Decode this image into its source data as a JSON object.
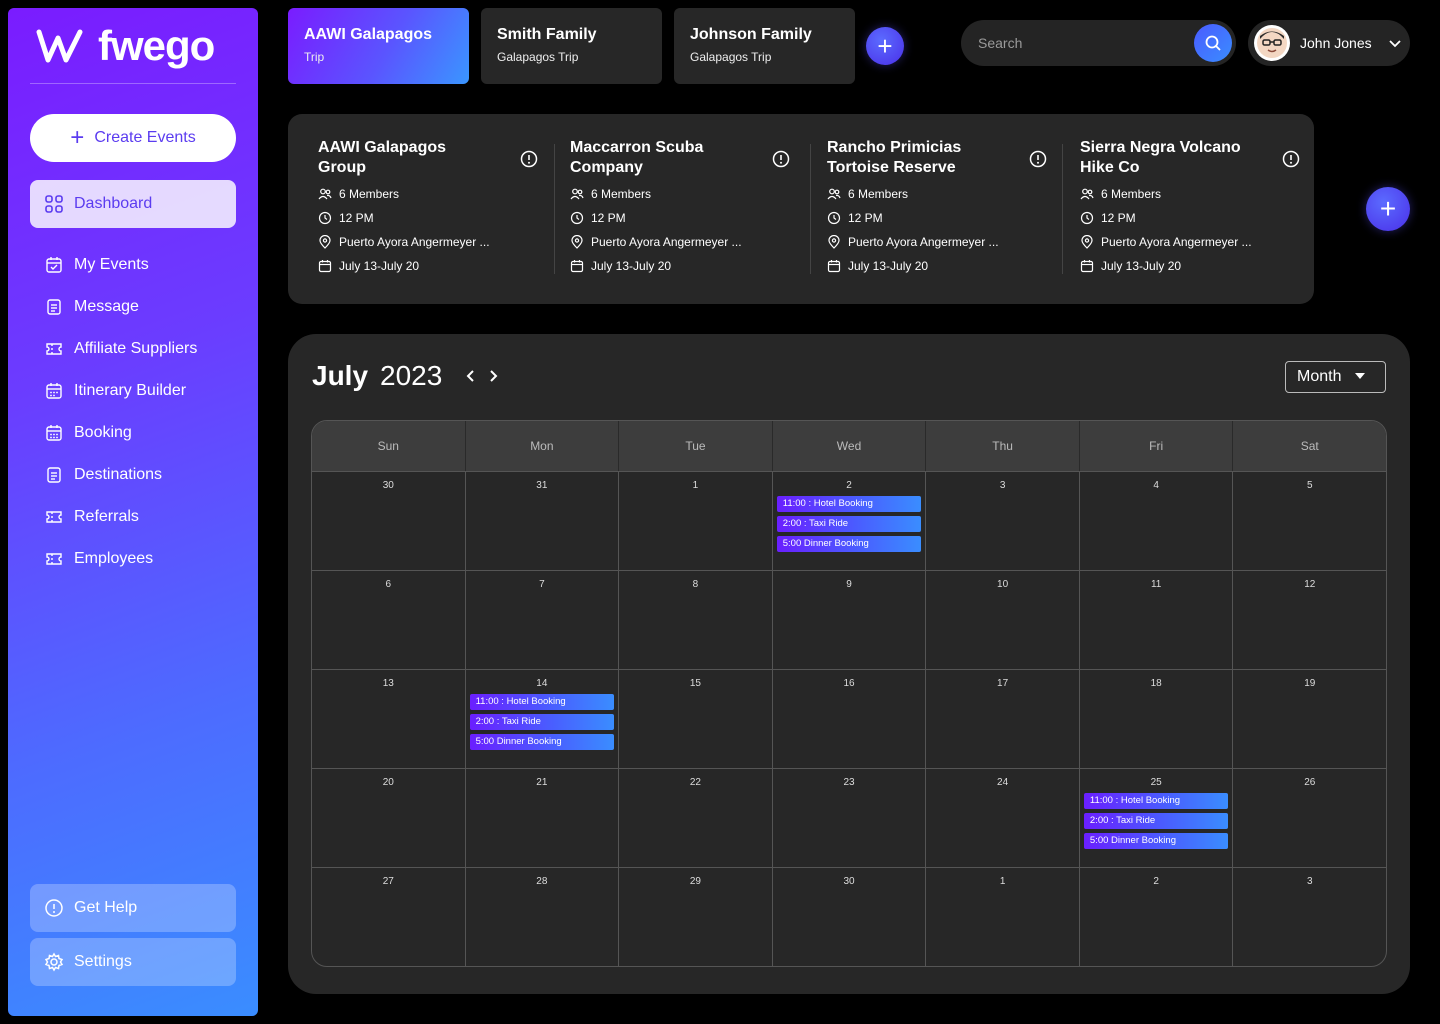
{
  "brand": {
    "name": "fwego"
  },
  "sidebar": {
    "create_label": "Create Events",
    "active": "Dashboard",
    "items": [
      {
        "label": "My Events",
        "icon": "calendar-icon"
      },
      {
        "label": "Message",
        "icon": "document-icon"
      },
      {
        "label": "Affiliate Suppliers",
        "icon": "ticket-icon"
      },
      {
        "label": "Itinerary Builder",
        "icon": "calendar-icon"
      },
      {
        "label": "Booking",
        "icon": "calendar-grid-icon"
      },
      {
        "label": "Destinations",
        "icon": "document-icon"
      },
      {
        "label": "Referrals",
        "icon": "ticket-icon"
      },
      {
        "label": "Employees",
        "icon": "ticket-icon"
      }
    ],
    "help_label": "Get Help",
    "settings_label": "Settings"
  },
  "trips": [
    {
      "title": "AAWI Galapagos",
      "subtitle": "Trip",
      "active": true
    },
    {
      "title": "Smith Family",
      "subtitle": "Galapagos Trip",
      "active": false
    },
    {
      "title": "Johnson Family",
      "subtitle": "Galapagos Trip",
      "active": false
    }
  ],
  "search": {
    "placeholder": "Search"
  },
  "user": {
    "name": "John Jones"
  },
  "groups": [
    {
      "name": "AAWI Galapagos Group",
      "members": "6 Members",
      "time": "12 PM",
      "location": "Puerto Ayora Angermeyer ...",
      "dates": "July 13-July 20"
    },
    {
      "name": "Maccarron Scuba Company",
      "members": "6 Members",
      "time": "12 PM",
      "location": "Puerto Ayora Angermeyer ...",
      "dates": "July 13-July 20"
    },
    {
      "name": "Rancho Primicias Tortoise Reserve",
      "members": "6 Members",
      "time": "12 PM",
      "location": "Puerto Ayora Angermeyer ...",
      "dates": "July 13-July 20"
    },
    {
      "name": "Sierra Negra Volcano Hike Co",
      "members": "6 Members",
      "time": "12 PM",
      "location": "Puerto Ayora Angermeyer ...",
      "dates": "July 13-July 20"
    }
  ],
  "calendar": {
    "month": "July",
    "year": "2023",
    "view": "Month",
    "weekdays": [
      "Sun",
      "Mon",
      "Tue",
      "Wed",
      "Thu",
      "Fri",
      "Sat"
    ],
    "weeks": [
      [
        "30",
        "31",
        "1",
        "2",
        "3",
        "4",
        "5"
      ],
      [
        "6",
        "7",
        "8",
        "9",
        "10",
        "11",
        "12"
      ],
      [
        "13",
        "14",
        "15",
        "16",
        "17",
        "18",
        "19"
      ],
      [
        "20",
        "21",
        "22",
        "23",
        "24",
        "25",
        "26"
      ],
      [
        "27",
        "28",
        "29",
        "30",
        "1",
        "2",
        "3"
      ]
    ],
    "events": [
      {
        "week": 0,
        "day": 3,
        "items": [
          "11:00 : Hotel Booking",
          "2:00 : Taxi Ride",
          "5:00 Dinner Booking"
        ]
      },
      {
        "week": 2,
        "day": 1,
        "items": [
          "11:00 : Hotel Booking",
          "2:00 : Taxi Ride",
          "5:00 Dinner Booking"
        ]
      },
      {
        "week": 3,
        "day": 5,
        "items": [
          "11:00 : Hotel Booking",
          "2:00 : Taxi Ride",
          "5:00 Dinner Booking"
        ]
      }
    ]
  }
}
